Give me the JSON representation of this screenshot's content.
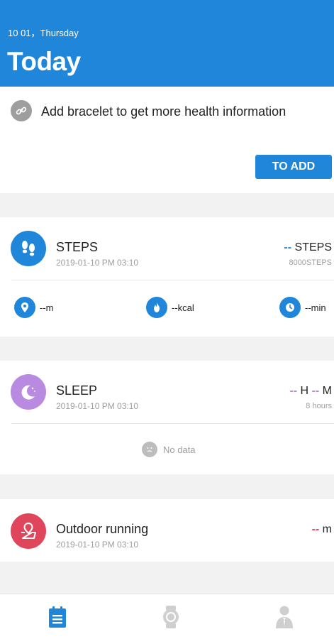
{
  "header": {
    "date": "10 01，Thursday",
    "title": "Today"
  },
  "bracelet": {
    "message": "Add bracelet to get more health information",
    "add_button": "TO ADD"
  },
  "steps": {
    "title": "STEPS",
    "timestamp": "2019-01-10 PM 03:10",
    "value_dash": "--",
    "value_unit": "STEPS",
    "goal": "8000STEPS",
    "distance": "--m",
    "calories": "--kcal",
    "duration": "--min"
  },
  "sleep": {
    "title": "SLEEP",
    "timestamp": "2019-01-10 PM 03:10",
    "hours_dash": "--",
    "hours_unit": "H",
    "minutes_dash": "--",
    "minutes_unit": "M",
    "goal": "8 hours",
    "no_data": "No data"
  },
  "running": {
    "title": "Outdoor running",
    "timestamp": "2019-01-10 PM 03:10",
    "value_dash": "--",
    "value_unit": "m"
  },
  "colors": {
    "primary": "#1f86d9",
    "sleep": "#b98be0",
    "running": "#e0465b",
    "muted": "#9e9e9e"
  },
  "nav": [
    "today-icon",
    "watch-icon",
    "profile-icon"
  ]
}
